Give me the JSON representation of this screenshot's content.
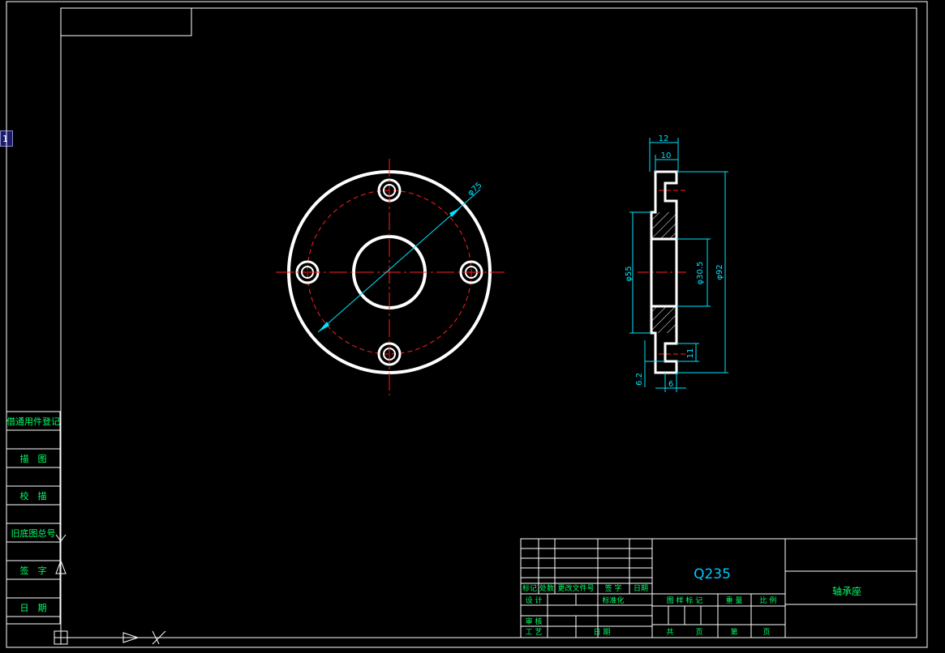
{
  "viewport_tab": "1",
  "title_block": {
    "material": "Q235",
    "part_name": "轴承座",
    "rev_headers": [
      "标记",
      "处数",
      "更改文件号",
      "签 字",
      "日期"
    ],
    "designer_label": "设 计",
    "standardize_label": "标准化",
    "review_label": "审 核",
    "process_label": "工 艺",
    "date_label": "日 期",
    "stage_mark_label": "图 样 标 记",
    "weight_label": "重 量",
    "scale_label": "比 例",
    "total_label": "共",
    "sheet_label": "页",
    "page_label": "第",
    "page_label2": "页"
  },
  "side_panel": {
    "items": [
      "借通用件登记",
      "描　图",
      "校　描",
      "旧底图总号",
      "签　字",
      "日　期"
    ]
  },
  "dimensions": {
    "d75": "φ75",
    "d55": "φ55",
    "d30_5": "φ30.5",
    "d92": "φ92",
    "w12": "12",
    "w10": "10",
    "w11": "11",
    "w6": "6",
    "w6_2": "6.2"
  },
  "colors": {
    "frame": "#ffffff",
    "table_lines": "#ffffff",
    "dimension": "#00e5ff",
    "centerline": "#ff2020",
    "part": "#ffffff",
    "cad_text": "#00ff66",
    "material_text": "#00c8ff"
  }
}
